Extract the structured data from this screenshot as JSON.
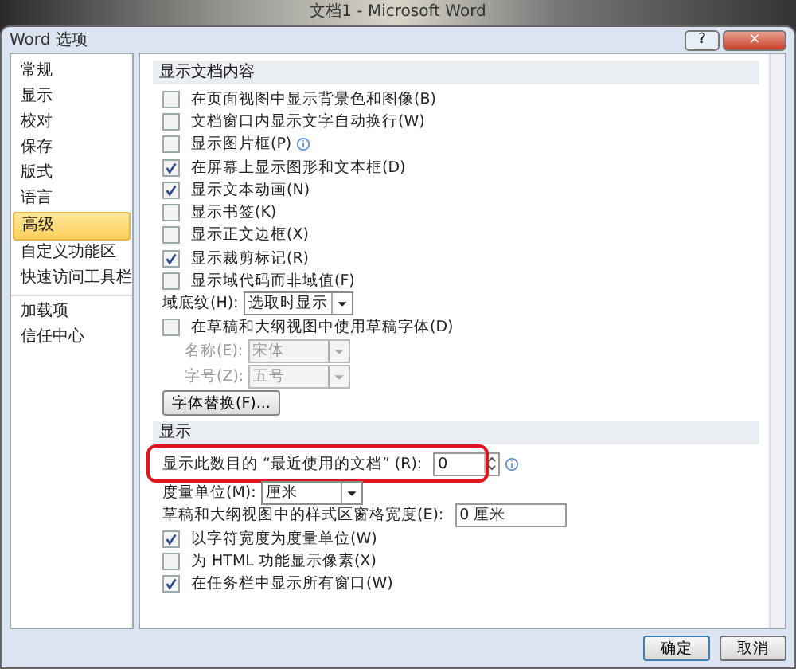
{
  "background_window": {
    "title": "文档1 - Microsoft Word"
  },
  "dialog": {
    "title": "Word 选项",
    "help": "?",
    "close": "×"
  },
  "sidebar": {
    "groups": [
      {
        "items": [
          {
            "label": "常规",
            "selected": false
          },
          {
            "label": "显示",
            "selected": false
          },
          {
            "label": "校对",
            "selected": false
          },
          {
            "label": "保存",
            "selected": false
          },
          {
            "label": "版式",
            "selected": false
          },
          {
            "label": "语言",
            "selected": false
          },
          {
            "label": "高级",
            "selected": true
          },
          {
            "label": "自定义功能区",
            "selected": false
          },
          {
            "label": "快速访问工具栏",
            "selected": false
          }
        ]
      },
      {
        "items": [
          {
            "label": "加载项",
            "selected": false
          },
          {
            "label": "信任中心",
            "selected": false
          }
        ]
      }
    ]
  },
  "sections": [
    {
      "title": "显示文档内容",
      "rows": [
        {
          "kind": "checkbox",
          "label": "在页面视图中显示背景色和图像(B)",
          "checked": false
        },
        {
          "kind": "checkbox",
          "label": "文档窗口内显示文字自动换行(W)",
          "checked": false
        },
        {
          "kind": "checkbox",
          "label": "显示图片框(P)",
          "checked": false,
          "info": true
        },
        {
          "kind": "checkbox",
          "label": "在屏幕上显示图形和文本框(D)",
          "checked": true
        },
        {
          "kind": "checkbox",
          "label": "显示文本动画(N)",
          "checked": true
        },
        {
          "kind": "checkbox",
          "label": "显示书签(K)",
          "checked": false
        },
        {
          "kind": "checkbox",
          "label": "显示正文边框(X)",
          "checked": false
        },
        {
          "kind": "checkbox",
          "label": "显示裁剪标记(R)",
          "checked": true
        },
        {
          "kind": "checkbox",
          "label": "显示域代码而非域值(F)",
          "checked": false
        },
        {
          "kind": "dropdown",
          "label": "域底纹(H):",
          "value": "选取时显示",
          "disabled": false
        },
        {
          "kind": "checkbox",
          "label": "在草稿和大纲视图中使用草稿字体(D)",
          "checked": false
        },
        {
          "kind": "dropdown",
          "label": "名称(E):",
          "value": "宋体",
          "disabled": true,
          "indent": true
        },
        {
          "kind": "dropdown",
          "label": "字号(Z):",
          "value": "五号",
          "disabled": true,
          "indent": true
        },
        {
          "kind": "button",
          "label": "字体替换(F)..."
        }
      ]
    },
    {
      "title": "显示",
      "rows": [
        {
          "kind": "spin",
          "label": "显示此数目的 “最近使用的文档” (R):",
          "value": "0",
          "info": true,
          "highlighted": true
        },
        {
          "kind": "dropdown",
          "label": "度量单位(M):",
          "value": "厘米",
          "disabled": false
        },
        {
          "kind": "text",
          "label": "草稿和大纲视图中的样式区窗格宽度(E):",
          "value": "0 厘米"
        },
        {
          "kind": "checkbox",
          "label": "以字符宽度为度量单位(W)",
          "checked": true
        },
        {
          "kind": "checkbox",
          "label": "为 HTML 功能显示像素(X)",
          "checked": false
        },
        {
          "kind": "checkbox",
          "label": "在任务栏中显示所有窗口(W)",
          "checked": true
        }
      ]
    }
  ],
  "buttons": [
    {
      "label": "确定",
      "default": true
    },
    {
      "label": "取消",
      "default": false
    }
  ]
}
